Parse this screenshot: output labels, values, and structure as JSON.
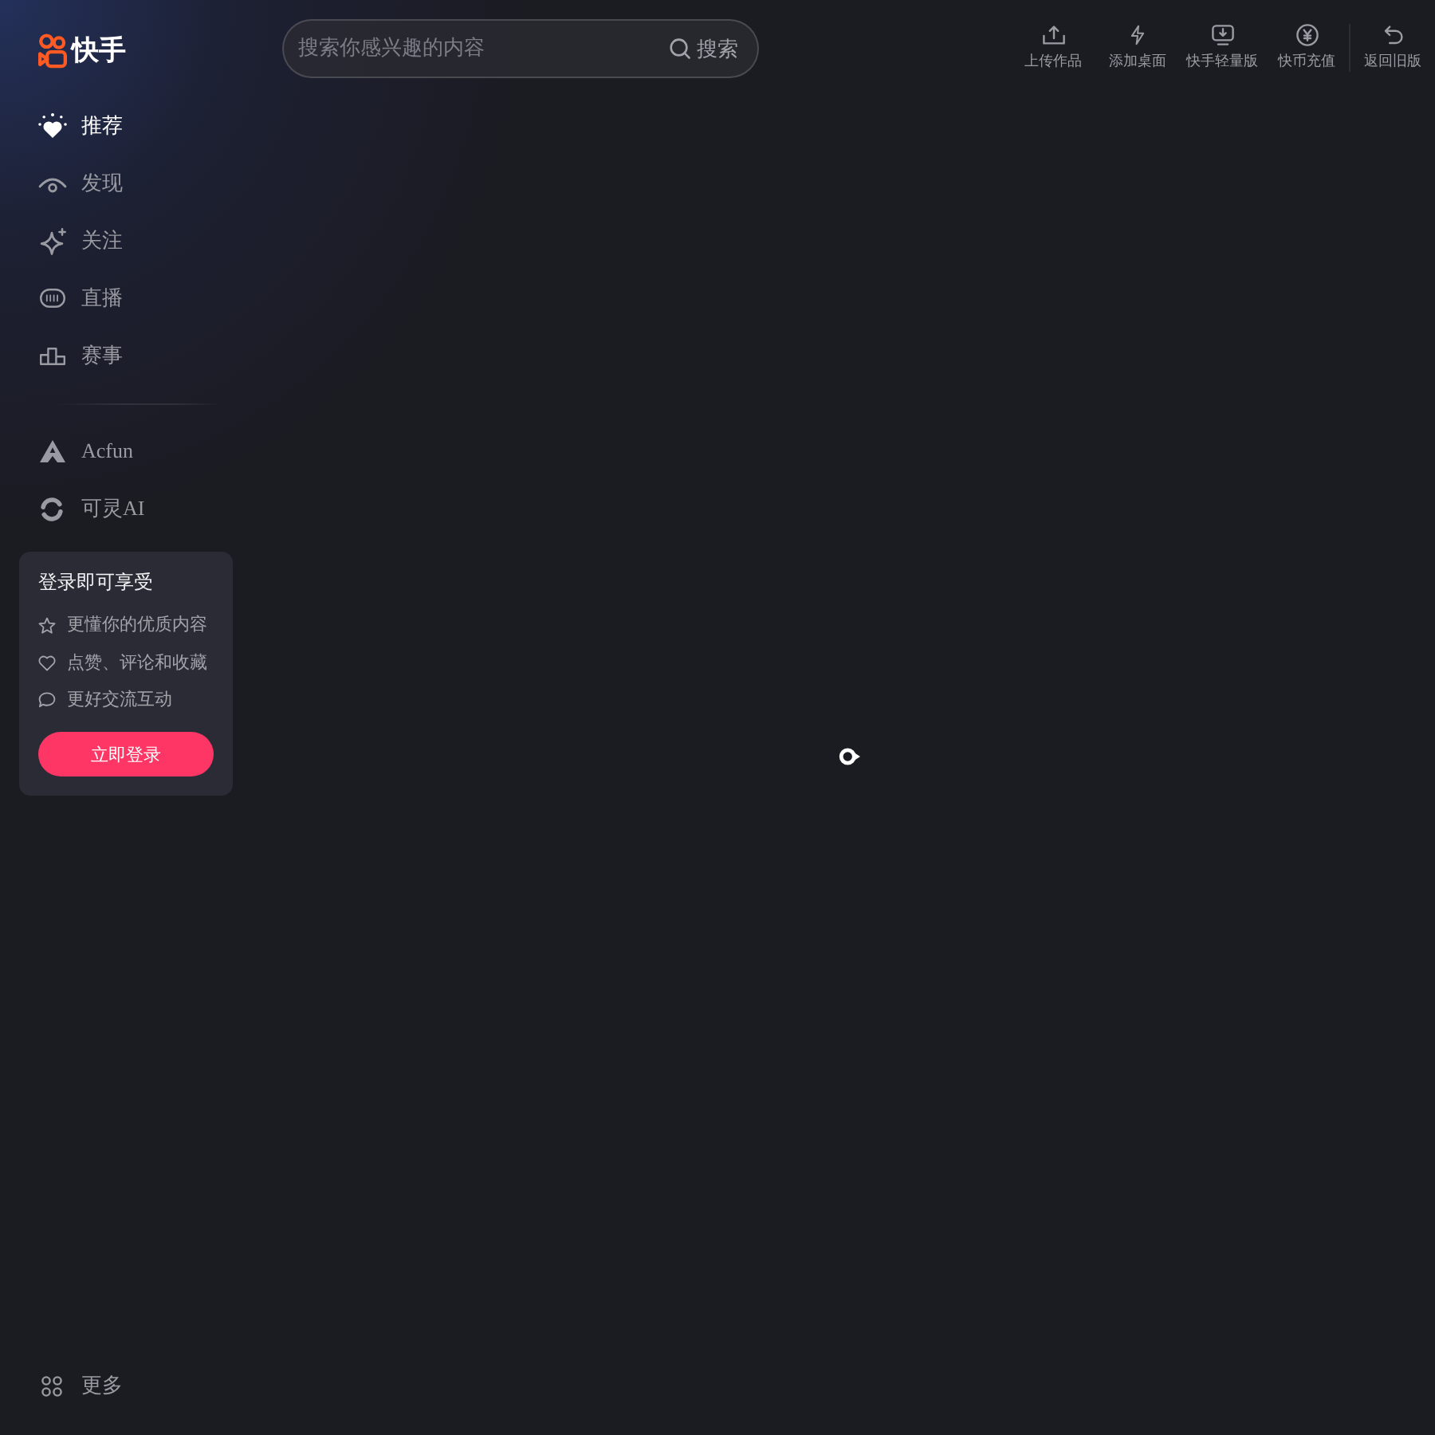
{
  "logo": {
    "text": "快手"
  },
  "search": {
    "placeholder": "搜索你感兴趣的内容",
    "button": "搜索"
  },
  "toolbar": {
    "actions": [
      {
        "label": "上传作品"
      },
      {
        "label": "添加桌面"
      },
      {
        "label": "快手轻量版"
      },
      {
        "label": "快币充值"
      }
    ],
    "back": {
      "label": "返回旧版"
    }
  },
  "sidebar": {
    "nav": [
      {
        "label": "推荐",
        "selected": true
      },
      {
        "label": "发现",
        "selected": false
      },
      {
        "label": "关注",
        "selected": false
      },
      {
        "label": "直播",
        "selected": false
      },
      {
        "label": "赛事",
        "selected": false
      }
    ],
    "apps": [
      {
        "label": "Acfun"
      },
      {
        "label": "可灵AI"
      }
    ],
    "more": {
      "label": "更多"
    }
  },
  "login_card": {
    "title": "登录即可享受",
    "perks": [
      "更懂你的优质内容",
      "点赞、评论和收藏",
      "更好交流互动"
    ],
    "button": "立即登录"
  }
}
